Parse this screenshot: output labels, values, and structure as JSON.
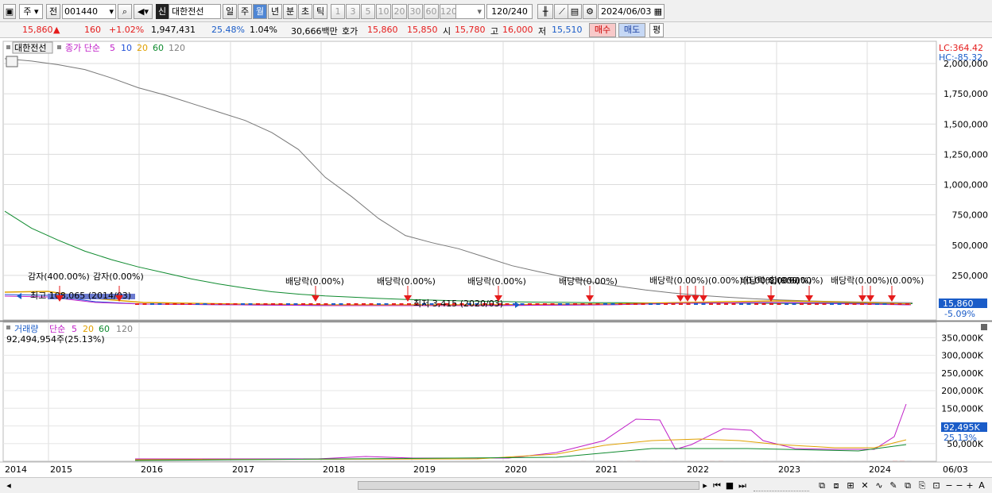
{
  "toolbar": {
    "market": "주",
    "code_type": "전",
    "code": "001440",
    "sin": "신",
    "name": "대한전선",
    "periods": [
      "일",
      "주",
      "월",
      "년",
      "분",
      "초",
      "틱"
    ],
    "selected_period": "월",
    "nums": [
      "1",
      "3",
      "5",
      "10",
      "20",
      "30",
      "60",
      "120"
    ],
    "count": "120",
    "count_total": "/240",
    "date": "2024/06/03"
  },
  "quote": {
    "price": "15,860",
    "change": "160",
    "change_pct": "+1.02%",
    "volume": "1,947,431",
    "turnover": "25.48%",
    "ratio": "1.04%",
    "amount": "30,666백만",
    "hoga_label": "호가",
    "ask": "15,860",
    "bid": "15,850",
    "open_label": "시",
    "open": "15,780",
    "high_label": "고",
    "high": "16,000",
    "low_label": "저",
    "low": "15,510",
    "buy_label": "매수",
    "sell_label": "매도",
    "avg_label": "평"
  },
  "colors": {
    "up": "#e51b1b",
    "down": "#1a5cc8",
    "ma5": "#c020c8",
    "ma10": "#2050d8",
    "ma20": "#e0a000",
    "ma60": "#0e8a2e",
    "ma120": "#808080"
  },
  "chart_data": [
    {
      "type": "line",
      "title": "대한전선",
      "series_legend": [
        "종가 단순",
        "5",
        "10",
        "20",
        "60",
        "120"
      ],
      "x": [
        "2014",
        "2015",
        "2016",
        "2017",
        "2018",
        "2019",
        "2020",
        "2021",
        "2022",
        "2023",
        "2024",
        "06/03"
      ],
      "ylim": [
        -85.32,
        2100000
      ],
      "y_ticks": [
        "2,000,000",
        "1,750,000",
        "1,500,000",
        "1,250,000",
        "1,000,000",
        "750,000",
        "500,000",
        "250,000"
      ],
      "lc_label": "LC:364.42",
      "hc_label": "HC:-85.32",
      "last_price_label": "15,860",
      "last_pct_label": "-5.09%",
      "ma120": [
        2040000,
        2020000,
        1990000,
        1950000,
        1880000,
        1800000,
        1740000,
        1670000,
        1600000,
        1530000,
        1430000,
        1290000,
        1060000,
        900000,
        720000,
        580000,
        520000,
        470000,
        400000,
        330000,
        280000,
        235000,
        195000,
        160000,
        130000,
        105000,
        85000,
        70000,
        58000,
        48000,
        40000,
        34000,
        30000,
        26000,
        24000
      ],
      "ma60": [
        780000,
        640000,
        540000,
        450000,
        380000,
        320000,
        270000,
        220000,
        180000,
        145000,
        115000,
        95000,
        80000,
        70000,
        60000,
        52000,
        46000,
        40000,
        36000,
        32000,
        29000,
        27000,
        25000,
        24000,
        23000,
        22000,
        22000,
        21000,
        20000,
        19000,
        18500,
        18000,
        17500,
        17000,
        16500
      ],
      "annotations": {
        "gamja1": "감자(400.00%)",
        "gamja2": "감자(0.00%)",
        "high": "최고 108,065 (2014/03)",
        "low": "최저 3,415 (2020/03)",
        "div1": "배당락(0.00%)",
        "div2": "배당락(0.00%)",
        "div3": "배당락(0.00%)",
        "div4": "배당락(0.00%)",
        "div_cluster": "배당락(0.00%)(0.00%)(0.00%)(0.00%)",
        "div5": "배당락(0.00%)",
        "merge1": "합(900.00%)",
        "div_cluster2": "배당락(0.00%)(0.00%)"
      }
    },
    {
      "type": "bar",
      "title": "거래량",
      "series_legend": [
        "단순",
        "5",
        "20",
        "60",
        "120"
      ],
      "total_label": "92,494,954주(25.13%)",
      "ylim": [
        0,
        380000
      ],
      "y_ticks": [
        "350,000K",
        "300,000K",
        "250,000K",
        "200,000K",
        "150,000K",
        "100,000K",
        "50,000K"
      ],
      "last_label": "92,495K",
      "last_pct": "25.13%",
      "bars": [
        [
          173,
          6,
          "u"
        ],
        [
          181,
          7,
          "u"
        ],
        [
          197,
          8,
          "u"
        ],
        [
          205,
          5,
          "d"
        ],
        [
          213,
          4,
          "u"
        ],
        [
          332,
          4,
          "u"
        ],
        [
          405,
          4,
          "u"
        ],
        [
          446,
          38,
          "u"
        ],
        [
          455,
          7,
          "u"
        ],
        [
          548,
          10,
          "u"
        ],
        [
          572,
          6,
          "u"
        ],
        [
          595,
          5,
          "u"
        ],
        [
          640,
          6,
          "u"
        ],
        [
          664,
          5,
          "d"
        ],
        [
          673,
          12,
          "u"
        ],
        [
          690,
          5,
          "d"
        ],
        [
          696,
          32,
          "u"
        ],
        [
          705,
          18,
          "u"
        ],
        [
          713,
          48,
          "u"
        ],
        [
          722,
          30,
          "u"
        ],
        [
          731,
          85,
          "u"
        ],
        [
          742,
          58,
          "d"
        ],
        [
          751,
          56,
          "d"
        ],
        [
          760,
          55,
          "u"
        ],
        [
          769,
          52,
          "d"
        ],
        [
          778,
          45,
          "d"
        ],
        [
          789,
          90,
          "u"
        ],
        [
          799,
          360,
          "u"
        ],
        [
          808,
          52,
          "d"
        ],
        [
          818,
          50,
          "u"
        ],
        [
          828,
          32,
          "u"
        ],
        [
          837,
          25,
          "d"
        ],
        [
          846,
          38,
          "u"
        ],
        [
          856,
          20,
          "d"
        ],
        [
          866,
          25,
          "u"
        ],
        [
          874,
          20,
          "u"
        ],
        [
          884,
          55,
          "u"
        ],
        [
          893,
          120,
          "u"
        ],
        [
          904,
          198,
          "u"
        ],
        [
          913,
          55,
          "d"
        ],
        [
          922,
          25,
          "d"
        ],
        [
          932,
          40,
          "u"
        ],
        [
          942,
          22,
          "d"
        ],
        [
          951,
          22,
          "d"
        ],
        [
          960,
          70,
          "u"
        ],
        [
          970,
          15,
          "d"
        ],
        [
          979,
          15,
          "d"
        ],
        [
          988,
          18,
          "u"
        ],
        [
          998,
          15,
          "u"
        ],
        [
          1007,
          60,
          "u"
        ],
        [
          1017,
          20,
          "d"
        ],
        [
          1026,
          18,
          "d"
        ],
        [
          1036,
          18,
          "u"
        ],
        [
          1046,
          22,
          "u"
        ],
        [
          1055,
          10,
          "d"
        ],
        [
          1065,
          15,
          "d"
        ],
        [
          1074,
          20,
          "u"
        ],
        [
          1084,
          30,
          "u"
        ],
        [
          1093,
          25,
          "d"
        ],
        [
          1102,
          15,
          "u"
        ],
        [
          1113,
          60,
          "u"
        ],
        [
          1123,
          295,
          "u"
        ],
        [
          1132,
          365,
          "u"
        ],
        [
          1141,
          92,
          "d"
        ]
      ]
    }
  ],
  "status": {
    "end_label": "06/03"
  }
}
